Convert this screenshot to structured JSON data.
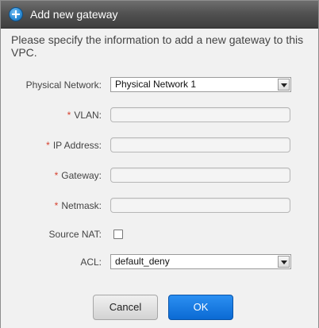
{
  "dialog": {
    "title": "Add new gateway",
    "description": "Please specify the information to add a new gateway to this VPC.",
    "required_marker": "*"
  },
  "form": {
    "physical_network": {
      "label": "Physical Network:",
      "value": "Physical Network 1"
    },
    "vlan": {
      "label": "VLAN:",
      "value": ""
    },
    "ip_address": {
      "label": "IP Address:",
      "value": ""
    },
    "gateway": {
      "label": "Gateway:",
      "value": ""
    },
    "netmask": {
      "label": "Netmask:",
      "value": ""
    },
    "source_nat": {
      "label": "Source NAT:",
      "checked": false
    },
    "acl": {
      "label": "ACL:",
      "value": "default_deny"
    }
  },
  "buttons": {
    "cancel": "Cancel",
    "ok": "OK"
  },
  "colors": {
    "titlebar": "#525252",
    "required": "#d6412f",
    "ok_button": "#1a7fe6"
  },
  "icons": {
    "title": "add-circle-icon",
    "dropdown": "chevron-down-icon"
  }
}
